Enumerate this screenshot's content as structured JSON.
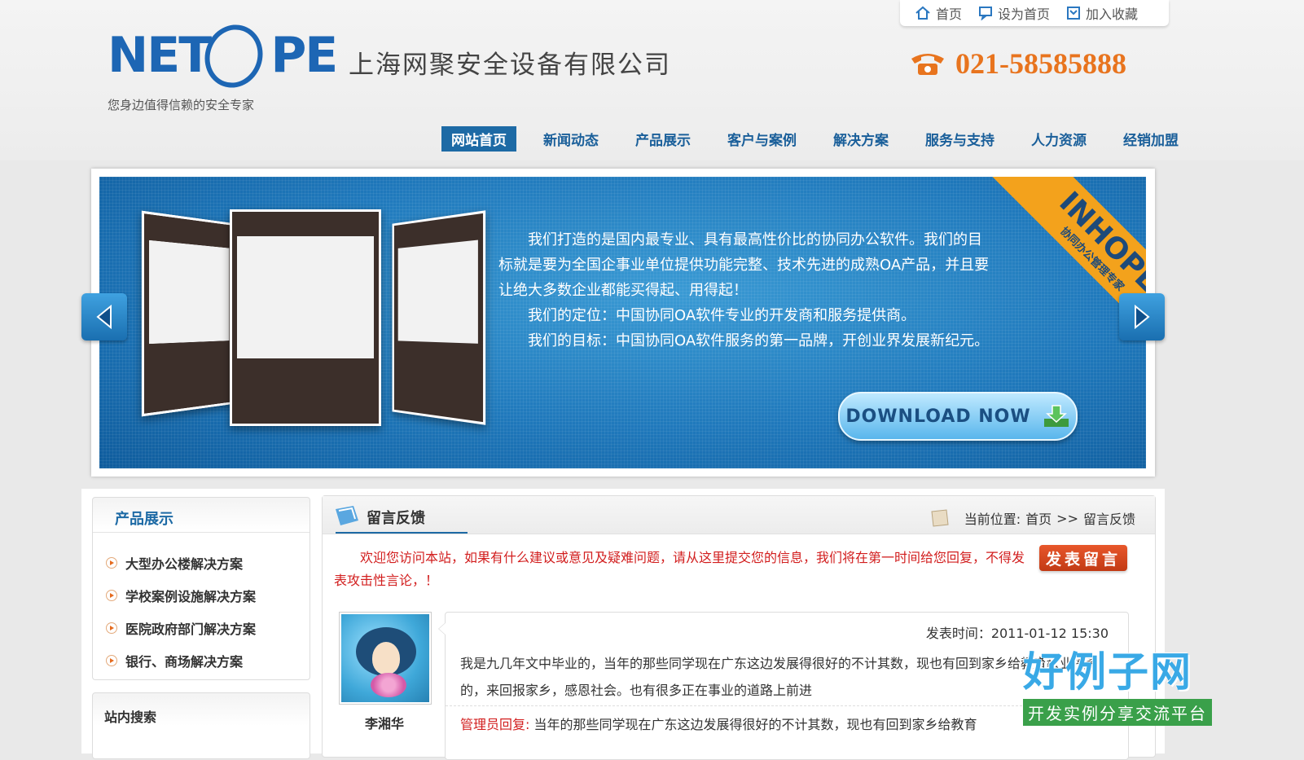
{
  "topbar": {
    "home": "首页",
    "set_home": "设为首页",
    "add_fav": "加入收藏"
  },
  "brand": {
    "logo_part1": "NET",
    "logo_part2": "PE",
    "company": "上海网聚安全设备有限公司",
    "slogan": "您身边值得信赖的安全专家",
    "phone": "021-58585888"
  },
  "nav": [
    {
      "label": "网站首页",
      "active": true
    },
    {
      "label": "新闻动态"
    },
    {
      "label": "产品展示"
    },
    {
      "label": "客户与案例"
    },
    {
      "label": "解决方案"
    },
    {
      "label": "服务与支持"
    },
    {
      "label": "人力资源"
    },
    {
      "label": "经销加盟"
    }
  ],
  "banner": {
    "lines": [
      "我们打造的是国内最专业、具有最高性价比的协同办公软件。我们的目",
      "标就是要为全国企事业单位提供功能完整、技术先进的成熟OA产品，并且要",
      "让绝大多数企业都能买得起、用得起！",
      "我们的定位：中国协同OA软件专业的开发商和服务提供商。",
      "我们的目标：中国协同OA软件服务的第一品牌，开创业界发展新纪元。"
    ],
    "ribbon_title": "INHOPE",
    "ribbon_sub": "协同办公管理专家",
    "download": "DOWNLOAD NOW"
  },
  "sidebar": {
    "title": "产品展示",
    "items": [
      {
        "label": "大型办公楼解决方案"
      },
      {
        "label": "学校案例设施解决方案"
      },
      {
        "label": "医院政府部门解决方案"
      },
      {
        "label": "银行、商场解决方案"
      }
    ],
    "search_title": "站内搜索"
  },
  "main": {
    "title": "留言反馈",
    "crumb_label": "当前位置:",
    "crumb_home": "首页",
    "crumb_sep": ">>",
    "crumb_current": "留言反馈",
    "notice": "欢迎您访问本站，如果有什么建议或意见及疑难问题，请从这里提交您的信息，我们将在第一时间给您回复，不得发表攻击性言论，！",
    "post_button": "发表留言",
    "message": {
      "user": "李湘华",
      "time": "发表时间：2011-01-12 15:30",
      "content": "我是九几年文中毕业的，当年的那些同学现在广东这边发展得很好的不计其数，现也有回到家乡给教育教业投资的，来回报家乡，感恩社会。也有很多正在事业的道路上前进",
      "reply_label": "管理员回复:",
      "reply": "当年的那些同学现在广东这边发展得很好的不计其数，现也有回到家乡给教育"
    }
  },
  "badge": {
    "big": "好例子网",
    "small": "开发实例分享交流平台"
  },
  "colors": {
    "brand_blue": "#1d66b4",
    "nav_active": "#1d6aa5",
    "phone_orange": "#e8741e",
    "notice_red": "#d21e1e"
  }
}
